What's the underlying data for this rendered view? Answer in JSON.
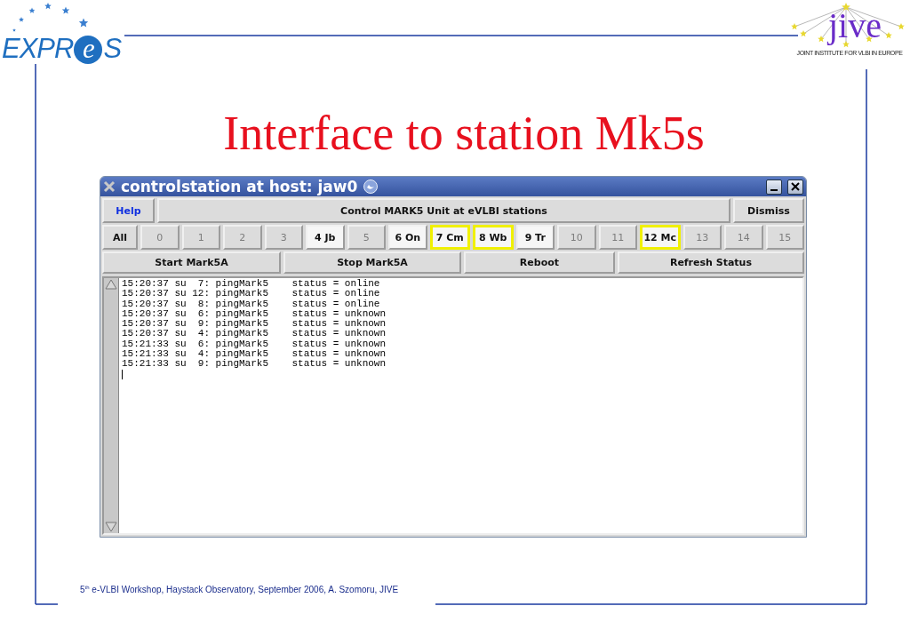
{
  "logos": {
    "left": {
      "before": "EXPR",
      "circled": "e",
      "after": "S"
    },
    "right": {
      "name": "jive",
      "caption": "JOINT INSTITUTE FOR VLBI IN EUROPE"
    }
  },
  "title": "Interface to station Mk5s",
  "window": {
    "title": "controlstation at host: jaw0",
    "help": "Help",
    "heading": "Control MARK5 Unit at eVLBI stations",
    "dismiss": "Dismiss",
    "all": "All",
    "stations": [
      {
        "label": "0",
        "disabled": true,
        "highlighted": false
      },
      {
        "label": "1",
        "disabled": true,
        "highlighted": false
      },
      {
        "label": "2",
        "disabled": true,
        "highlighted": false
      },
      {
        "label": "3",
        "disabled": true,
        "highlighted": false
      },
      {
        "label": "4 Jb",
        "disabled": false,
        "highlighted": false
      },
      {
        "label": "5",
        "disabled": true,
        "highlighted": false
      },
      {
        "label": "6 On",
        "disabled": false,
        "highlighted": false
      },
      {
        "label": "7 Cm",
        "disabled": false,
        "highlighted": true
      },
      {
        "label": "8 Wb",
        "disabled": false,
        "highlighted": true
      },
      {
        "label": "9 Tr",
        "disabled": false,
        "highlighted": false
      },
      {
        "label": "10",
        "disabled": true,
        "highlighted": false
      },
      {
        "label": "11",
        "disabled": true,
        "highlighted": false
      },
      {
        "label": "12 Mc",
        "disabled": false,
        "highlighted": true
      },
      {
        "label": "13",
        "disabled": true,
        "highlighted": false
      },
      {
        "label": "14",
        "disabled": true,
        "highlighted": false
      },
      {
        "label": "15",
        "disabled": true,
        "highlighted": false
      }
    ],
    "actions": [
      "Start Mark5A",
      "Stop Mark5A",
      "Reboot",
      "Refresh Status"
    ],
    "log": [
      "15:20:37 su  7: pingMark5    status = online",
      "15:20:37 su 12: pingMark5    status = online",
      "15:20:37 su  8: pingMark5    status = online",
      "15:20:37 su  6: pingMark5    status = unknown",
      "15:20:37 su  9: pingMark5    status = unknown",
      "15:20:37 su  4: pingMark5    status = unknown",
      "15:21:33 su  6: pingMark5    status = unknown",
      "15:21:33 su  4: pingMark5    status = unknown",
      "15:21:33 su  9: pingMark5    status = unknown"
    ]
  },
  "footer": "5$^{th}$ e-VLBI Workshop, Haystack Observatory, September 2006, A. Szomoru, JIVE"
}
